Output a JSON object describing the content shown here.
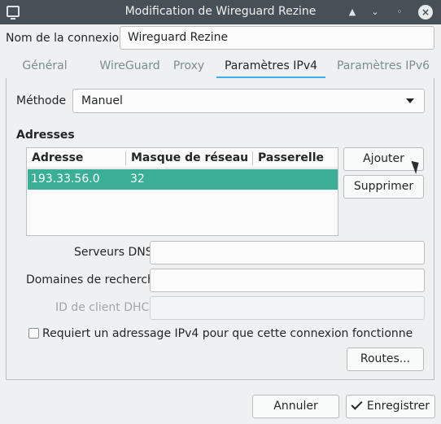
{
  "window": {
    "title": "Modification de Wireguard Rezine",
    "controls": [
      "keep-above",
      "minimize",
      "maximize",
      "close"
    ],
    "control_glyphs": {
      "keep_above": "▲",
      "minimize": "⌄",
      "maximize": "◦",
      "close": "×"
    }
  },
  "connection": {
    "name_label": "Nom de la connexion",
    "name_value": "Wireguard Rezine"
  },
  "tabs": [
    {
      "label": "Général",
      "active": false
    },
    {
      "label": "WireGuard",
      "active": false
    },
    {
      "label": "Proxy",
      "active": false
    },
    {
      "label": "Paramètres IPv4",
      "active": true
    },
    {
      "label": "Paramètres IPv6",
      "active": false
    }
  ],
  "ipv4": {
    "method_label": "Méthode",
    "method_value": "Manuel",
    "addresses_title": "Adresses",
    "table": {
      "columns": [
        "Adresse",
        "Masque de réseau",
        "Passerelle"
      ],
      "rows": [
        {
          "address": "193.33.56.0",
          "netmask": "32",
          "gateway": "",
          "selected": true
        }
      ]
    },
    "add_button": "Ajouter",
    "remove_button": "Supprimer",
    "dns_label": "Serveurs DNS",
    "dns_value": "",
    "search_domains_label": "Domaines de recherche",
    "search_domains_value": "",
    "dhcp_client_id_label": "ID de client DHCP",
    "dhcp_client_id_value": "",
    "require_ipv4_label": "Requiert un adressage IPv4 pour que cette connexion fonctionne",
    "require_ipv4_checked": false,
    "routes_button": "Routes..."
  },
  "footer": {
    "cancel_button": "Annuler",
    "save_button": "Enregistrer"
  },
  "colors": {
    "titlebar": "#475057",
    "accent_tab": "#3daee9",
    "selection": "#3aaf96",
    "window_bg": "#eff0f1"
  }
}
